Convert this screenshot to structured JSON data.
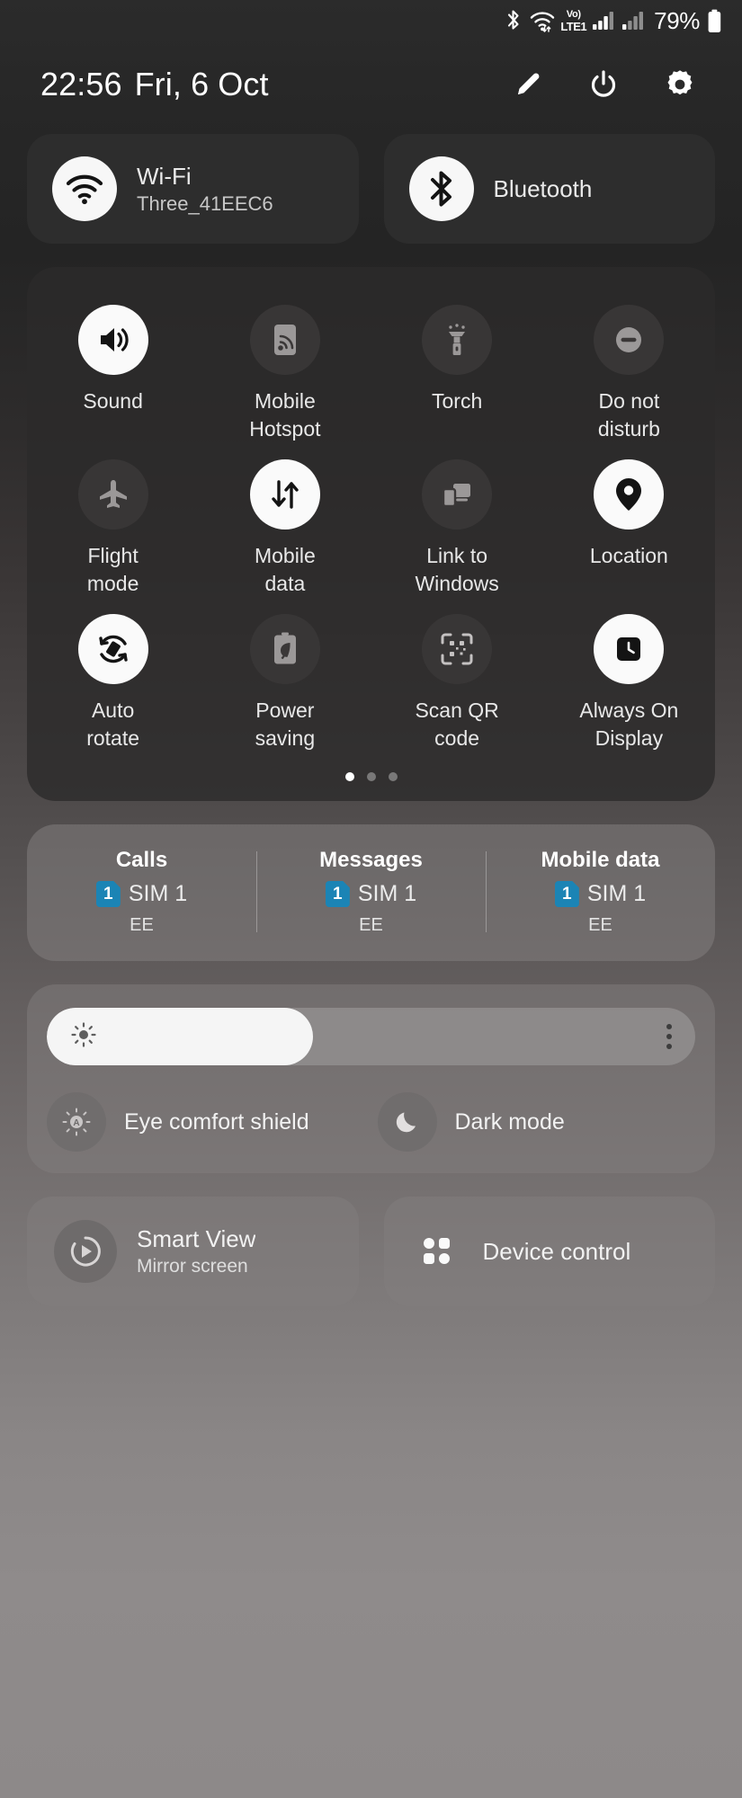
{
  "status_bar": {
    "battery_percent": "79%",
    "volte_top": "Vo)",
    "volte_bottom": "LTE1",
    "icons": [
      "bluetooth-icon",
      "wifi-icon",
      "volte-icon",
      "signal-icon-1",
      "signal-icon-2",
      "battery-icon"
    ]
  },
  "header": {
    "time": "22:56",
    "date": "Fri, 6 Oct",
    "actions": [
      "edit-pencil-icon",
      "power-icon",
      "settings-gear-icon"
    ]
  },
  "connectivity": [
    {
      "name": "wifi",
      "title": "Wi-Fi",
      "subtitle": "Three_41EEC6",
      "state": "on"
    },
    {
      "name": "bluetooth",
      "title": "Bluetooth",
      "subtitle": "",
      "state": "on"
    }
  ],
  "toggles": [
    {
      "label": "Sound",
      "icon": "sound-icon",
      "state": "on"
    },
    {
      "label": "Mobile\nHotspot",
      "icon": "hotspot-icon",
      "state": "off"
    },
    {
      "label": "Torch",
      "icon": "torch-icon",
      "state": "off"
    },
    {
      "label": "Do not\ndisturb",
      "icon": "do-not-disturb-icon",
      "state": "off"
    },
    {
      "label": "Flight\nmode",
      "icon": "flight-mode-icon",
      "state": "off"
    },
    {
      "label": "Mobile\ndata",
      "icon": "mobile-data-icon",
      "state": "on"
    },
    {
      "label": "Link to\nWindows",
      "icon": "link-to-windows-icon",
      "state": "off"
    },
    {
      "label": "Location",
      "icon": "location-icon",
      "state": "on"
    },
    {
      "label": "Auto\nrotate",
      "icon": "auto-rotate-icon",
      "state": "on"
    },
    {
      "label": "Power\nsaving",
      "icon": "power-saving-icon",
      "state": "off"
    },
    {
      "label": "Scan QR\ncode",
      "icon": "scan-qr-icon",
      "state": "off"
    },
    {
      "label": "Always On\nDisplay",
      "icon": "always-on-display-icon",
      "state": "on"
    }
  ],
  "pager": {
    "total": 3,
    "active_index": 0
  },
  "sim_panel": {
    "badge_color": "#1b84b5",
    "columns": [
      {
        "header": "Calls",
        "badge": "1",
        "sim": "SIM 1",
        "carrier": "EE"
      },
      {
        "header": "Messages",
        "badge": "1",
        "sim": "SIM 1",
        "carrier": "EE"
      },
      {
        "header": "Mobile data",
        "badge": "1",
        "sim": "SIM 1",
        "carrier": "EE"
      }
    ]
  },
  "brightness": {
    "value_percent": 41,
    "icon": "brightness-sun-icon",
    "menu_icon": "more-options-icon"
  },
  "display_modes": [
    {
      "label": "Eye comfort shield",
      "icon": "eye-comfort-shield-icon",
      "state": "off"
    },
    {
      "label": "Dark mode",
      "icon": "dark-mode-moon-icon",
      "state": "off"
    }
  ],
  "bottom_cards": [
    {
      "title": "Smart View",
      "subtitle": "Mirror screen",
      "icon": "smart-view-icon"
    },
    {
      "title": "Device control",
      "subtitle": "",
      "icon": "device-control-icon"
    }
  ]
}
